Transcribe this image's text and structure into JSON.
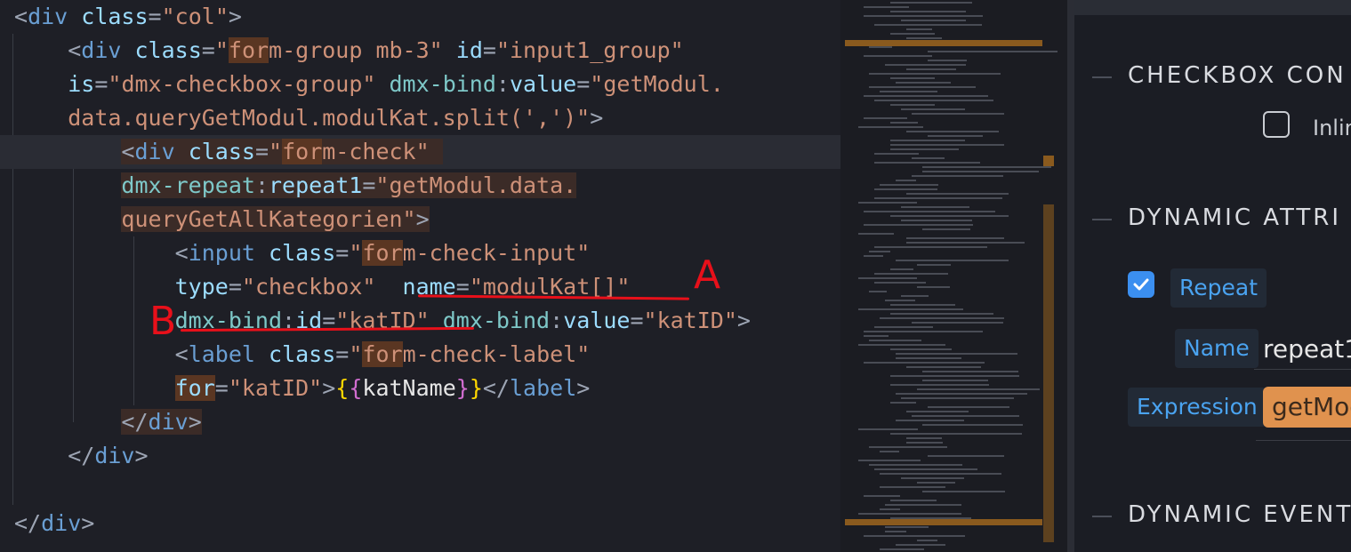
{
  "editor": {
    "lines": [
      [
        {
          "t": "<",
          "c": "tk-punct"
        },
        {
          "t": "div",
          "c": "tk-tag"
        },
        {
          "t": " ",
          "c": "tk-text"
        },
        {
          "t": "class",
          "c": "tk-attr"
        },
        {
          "t": "=",
          "c": "tk-punct"
        },
        {
          "t": "\"col\"",
          "c": "tk-str"
        },
        {
          "t": ">",
          "c": "tk-punct"
        }
      ],
      [
        {
          "t": "    ",
          "c": "tk-text"
        },
        {
          "t": "<",
          "c": "tk-punct"
        },
        {
          "t": "div",
          "c": "tk-tag"
        },
        {
          "t": " ",
          "c": "tk-text"
        },
        {
          "t": "class",
          "c": "tk-attr"
        },
        {
          "t": "=",
          "c": "tk-punct"
        },
        {
          "t": "\"",
          "c": "tk-str"
        },
        {
          "t": "for",
          "c": "tk-str hl-strong"
        },
        {
          "t": "m-group mb-3\"",
          "c": "tk-str"
        },
        {
          "t": " ",
          "c": "tk-text"
        },
        {
          "t": "id",
          "c": "tk-attr"
        },
        {
          "t": "=",
          "c": "tk-punct"
        },
        {
          "t": "\"input1_group\"",
          "c": "tk-str"
        }
      ],
      [
        {
          "t": "    ",
          "c": "tk-text"
        },
        {
          "t": "is",
          "c": "tk-attr"
        },
        {
          "t": "=",
          "c": "tk-punct"
        },
        {
          "t": "\"dmx-checkbox-group\"",
          "c": "tk-str"
        },
        {
          "t": " ",
          "c": "tk-text"
        },
        {
          "t": "dmx-bind",
          "c": "tk-dmx"
        },
        {
          "t": ":",
          "c": "tk-punct"
        },
        {
          "t": "value",
          "c": "tk-attr"
        },
        {
          "t": "=",
          "c": "tk-punct"
        },
        {
          "t": "\"getModul.",
          "c": "tk-str"
        }
      ],
      [
        {
          "t": "    ",
          "c": "tk-text"
        },
        {
          "t": "data.queryGetModul.modulKat.split(',')\"",
          "c": "tk-str"
        },
        {
          "t": ">",
          "c": "tk-punct"
        }
      ],
      [
        {
          "t": "        ",
          "c": "tk-text"
        },
        {
          "t": "<",
          "c": "tk-punct hl"
        },
        {
          "t": "div",
          "c": "tk-tag hl"
        },
        {
          "t": " ",
          "c": "tk-text hl"
        },
        {
          "t": "class",
          "c": "tk-attr hl"
        },
        {
          "t": "=",
          "c": "tk-punct hl"
        },
        {
          "t": "\"",
          "c": "tk-str hl"
        },
        {
          "t": "for",
          "c": "tk-str hl-strong"
        },
        {
          "t": "m-check\" ",
          "c": "tk-str hl"
        }
      ],
      [
        {
          "t": "        ",
          "c": "tk-text"
        },
        {
          "t": "dmx-repeat",
          "c": "tk-dmx hl"
        },
        {
          "t": ":",
          "c": "tk-punct hl"
        },
        {
          "t": "repeat1",
          "c": "tk-attr hl"
        },
        {
          "t": "=",
          "c": "tk-punct hl"
        },
        {
          "t": "\"getModul.data.",
          "c": "tk-str hl"
        }
      ],
      [
        {
          "t": "        ",
          "c": "tk-text"
        },
        {
          "t": "queryGetAllKategorien\"",
          "c": "tk-str hl"
        },
        {
          "t": ">",
          "c": "tk-punct hl"
        }
      ],
      [
        {
          "t": "            ",
          "c": "tk-text"
        },
        {
          "t": "<",
          "c": "tk-punct"
        },
        {
          "t": "input",
          "c": "tk-tag"
        },
        {
          "t": " ",
          "c": "tk-text"
        },
        {
          "t": "class",
          "c": "tk-attr"
        },
        {
          "t": "=",
          "c": "tk-punct"
        },
        {
          "t": "\"",
          "c": "tk-str"
        },
        {
          "t": "for",
          "c": "tk-str hl-strong"
        },
        {
          "t": "m-check-input\"",
          "c": "tk-str"
        }
      ],
      [
        {
          "t": "            ",
          "c": "tk-text"
        },
        {
          "t": "type",
          "c": "tk-attr"
        },
        {
          "t": "=",
          "c": "tk-punct"
        },
        {
          "t": "\"checkbox\"",
          "c": "tk-str"
        },
        {
          "t": "  ",
          "c": "tk-text"
        },
        {
          "t": "name",
          "c": "tk-attr"
        },
        {
          "t": "=",
          "c": "tk-punct"
        },
        {
          "t": "\"modulKat[]\"",
          "c": "tk-str"
        }
      ],
      [
        {
          "t": "            ",
          "c": "tk-text"
        },
        {
          "t": "dmx-bind",
          "c": "tk-dmx"
        },
        {
          "t": ":",
          "c": "tk-punct"
        },
        {
          "t": "id",
          "c": "tk-attr"
        },
        {
          "t": "=",
          "c": "tk-punct"
        },
        {
          "t": "\"katID\"",
          "c": "tk-str"
        },
        {
          "t": " ",
          "c": "tk-text"
        },
        {
          "t": "dmx-bind",
          "c": "tk-dmx"
        },
        {
          "t": ":",
          "c": "tk-punct"
        },
        {
          "t": "value",
          "c": "tk-attr"
        },
        {
          "t": "=",
          "c": "tk-punct"
        },
        {
          "t": "\"katID\"",
          "c": "tk-str"
        },
        {
          "t": ">",
          "c": "tk-punct"
        }
      ],
      [
        {
          "t": "            ",
          "c": "tk-text"
        },
        {
          "t": "<",
          "c": "tk-punct"
        },
        {
          "t": "label",
          "c": "tk-tag"
        },
        {
          "t": " ",
          "c": "tk-text"
        },
        {
          "t": "class",
          "c": "tk-attr"
        },
        {
          "t": "=",
          "c": "tk-punct"
        },
        {
          "t": "\"",
          "c": "tk-str"
        },
        {
          "t": "for",
          "c": "tk-str hl-strong"
        },
        {
          "t": "m-check-label\"",
          "c": "tk-str"
        }
      ],
      [
        {
          "t": "            ",
          "c": "tk-text"
        },
        {
          "t": "for",
          "c": "tk-attr hl-strong"
        },
        {
          "t": "=",
          "c": "tk-punct"
        },
        {
          "t": "\"katID\"",
          "c": "tk-str"
        },
        {
          "t": ">",
          "c": "tk-punct"
        },
        {
          "t": "{",
          "c": "tk-brace"
        },
        {
          "t": "{",
          "c": "tk-brace2"
        },
        {
          "t": "katName",
          "c": "tk-text"
        },
        {
          "t": "}",
          "c": "tk-brace2"
        },
        {
          "t": "}",
          "c": "tk-brace"
        },
        {
          "t": "</",
          "c": "tk-punct"
        },
        {
          "t": "label",
          "c": "tk-tag"
        },
        {
          "t": ">",
          "c": "tk-punct"
        }
      ],
      [
        {
          "t": "        ",
          "c": "tk-text"
        },
        {
          "t": "</",
          "c": "tk-punct hl"
        },
        {
          "t": "div",
          "c": "tk-tag hl"
        },
        {
          "t": ">",
          "c": "tk-punct hl"
        }
      ],
      [
        {
          "t": "    ",
          "c": "tk-text"
        },
        {
          "t": "</",
          "c": "tk-punct"
        },
        {
          "t": "div",
          "c": "tk-tag"
        },
        {
          "t": ">",
          "c": "tk-punct"
        }
      ],
      [],
      [
        {
          "t": "</",
          "c": "tk-punct"
        },
        {
          "t": "div",
          "c": "tk-tag"
        },
        {
          "t": ">",
          "c": "tk-punct"
        }
      ]
    ],
    "current_line": 4
  },
  "annotations": {
    "a_label": "A",
    "b_label": "B",
    "color": "#e8101a"
  },
  "panel": {
    "sections": {
      "checkbox_config": "CHECKBOX CON",
      "dynamic_attributes": "DYNAMIC ATTRI",
      "dynamic_events": "DYNAMIC EVENT"
    },
    "inline_label": "Inlin",
    "repeat": {
      "label": "Repeat",
      "checked": true,
      "name_label": "Name",
      "name_value": "repeat1",
      "expression_label": "Expression",
      "expression_value": "getMod"
    },
    "colors": {
      "accent": "#3b8ff0",
      "expression_fill": "#e0924e",
      "link": "#4aa3f0"
    }
  }
}
